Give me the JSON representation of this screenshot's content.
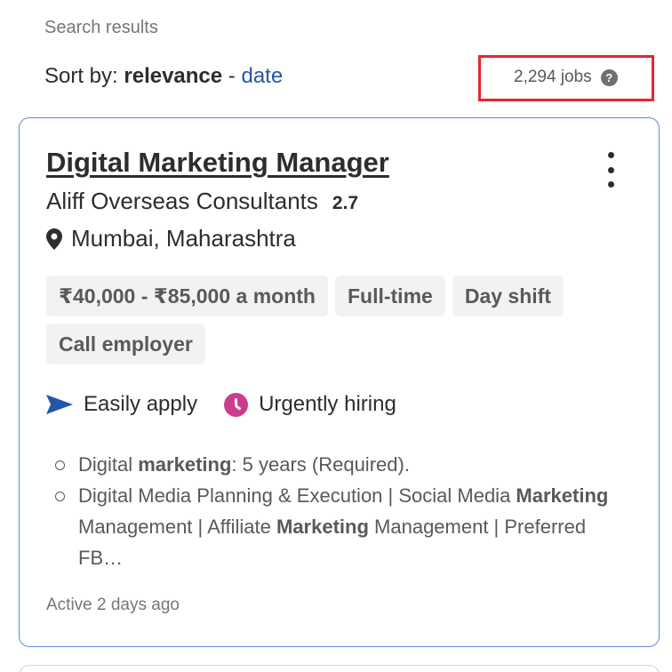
{
  "header": {
    "search_results_label": "Search results",
    "sort_prefix": "Sort by: ",
    "sort_active": "relevance",
    "sort_separator": " - ",
    "sort_alt": "date",
    "job_count": "2,294 jobs",
    "help_glyph": "?"
  },
  "job": {
    "title": "Digital Marketing Manager",
    "company": "Aliff Overseas Consultants",
    "rating": "2.7",
    "location": "Mumbai, Maharashtra",
    "tags": [
      "₹40,000 - ₹85,000 a month",
      "Full-time",
      "Day shift",
      "Call employer"
    ],
    "easily_apply": "Easily apply",
    "urgently_hiring": "Urgently hiring",
    "snippet": {
      "line1_pre": "Digital ",
      "line1_bold": "marketing",
      "line1_post": ": 5 years (Required).",
      "line2_a": "Digital Media Planning & Execution | Social Media ",
      "line2_b_bold": "Marketing",
      "line2_c": " Management | Affiliate ",
      "line2_d_bold": "Marketing",
      "line2_e": " Management | Preferred FB…"
    },
    "active": "Active 2 days ago"
  },
  "colors": {
    "link": "#2557a7",
    "highlight_box": "#e8262d",
    "card_border": "#5a8fd6",
    "urgent_icon": "#cd3b8e",
    "apply_icon": "#2557a7"
  },
  "icons": [
    "help-icon",
    "more-options-icon",
    "location-pin-icon",
    "send-arrow-icon",
    "clock-icon"
  ]
}
